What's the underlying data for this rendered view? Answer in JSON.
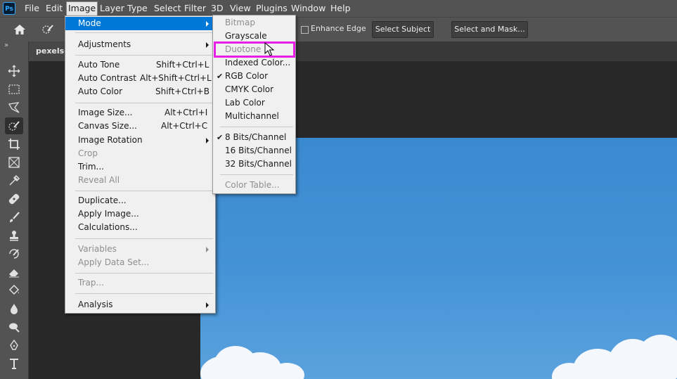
{
  "app": {
    "logo": "Ps"
  },
  "menubar": {
    "items": [
      "File",
      "Edit",
      "Image",
      "Layer",
      "Type",
      "Select",
      "Filter",
      "3D",
      "View",
      "Plugins",
      "Window",
      "Help"
    ],
    "active": "Image"
  },
  "options": {
    "enhance_edge": "Enhance Edge",
    "select_subject": "Select Subject",
    "select_and_mask": "Select and Mask..."
  },
  "document": {
    "tab_label": "pexels-p"
  },
  "image_menu": {
    "mode": "Mode",
    "adjustments": "Adjustments",
    "auto_tone": {
      "label": "Auto Tone",
      "shortcut": "Shift+Ctrl+L"
    },
    "auto_contrast": {
      "label": "Auto Contrast",
      "shortcut": "Alt+Shift+Ctrl+L"
    },
    "auto_color": {
      "label": "Auto Color",
      "shortcut": "Shift+Ctrl+B"
    },
    "image_size": {
      "label": "Image Size...",
      "shortcut": "Alt+Ctrl+I"
    },
    "canvas_size": {
      "label": "Canvas Size...",
      "shortcut": "Alt+Ctrl+C"
    },
    "image_rotation": "Image Rotation",
    "crop": "Crop",
    "trim": "Trim...",
    "reveal_all": "Reveal All",
    "duplicate": "Duplicate...",
    "apply_image": "Apply Image...",
    "calculations": "Calculations...",
    "variables": "Variables",
    "apply_data_set": "Apply Data Set...",
    "trap": "Trap...",
    "analysis": "Analysis"
  },
  "mode_menu": {
    "bitmap": "Bitmap",
    "grayscale": "Grayscale",
    "duotone": "Duotone",
    "indexed_color": "Indexed Color...",
    "rgb_color": "RGB Color",
    "cmyk_color": "CMYK Color",
    "lab_color": "Lab Color",
    "multichannel": "Multichannel",
    "bits8": "8 Bits/Channel",
    "bits16": "16 Bits/Channel",
    "bits32": "32 Bits/Channel",
    "color_table": "Color Table...",
    "check_mark": "✔"
  },
  "colors": {
    "highlight_menu": "#0078d7",
    "annotation_box": "#e61ee6",
    "sky": "#4593d6"
  }
}
